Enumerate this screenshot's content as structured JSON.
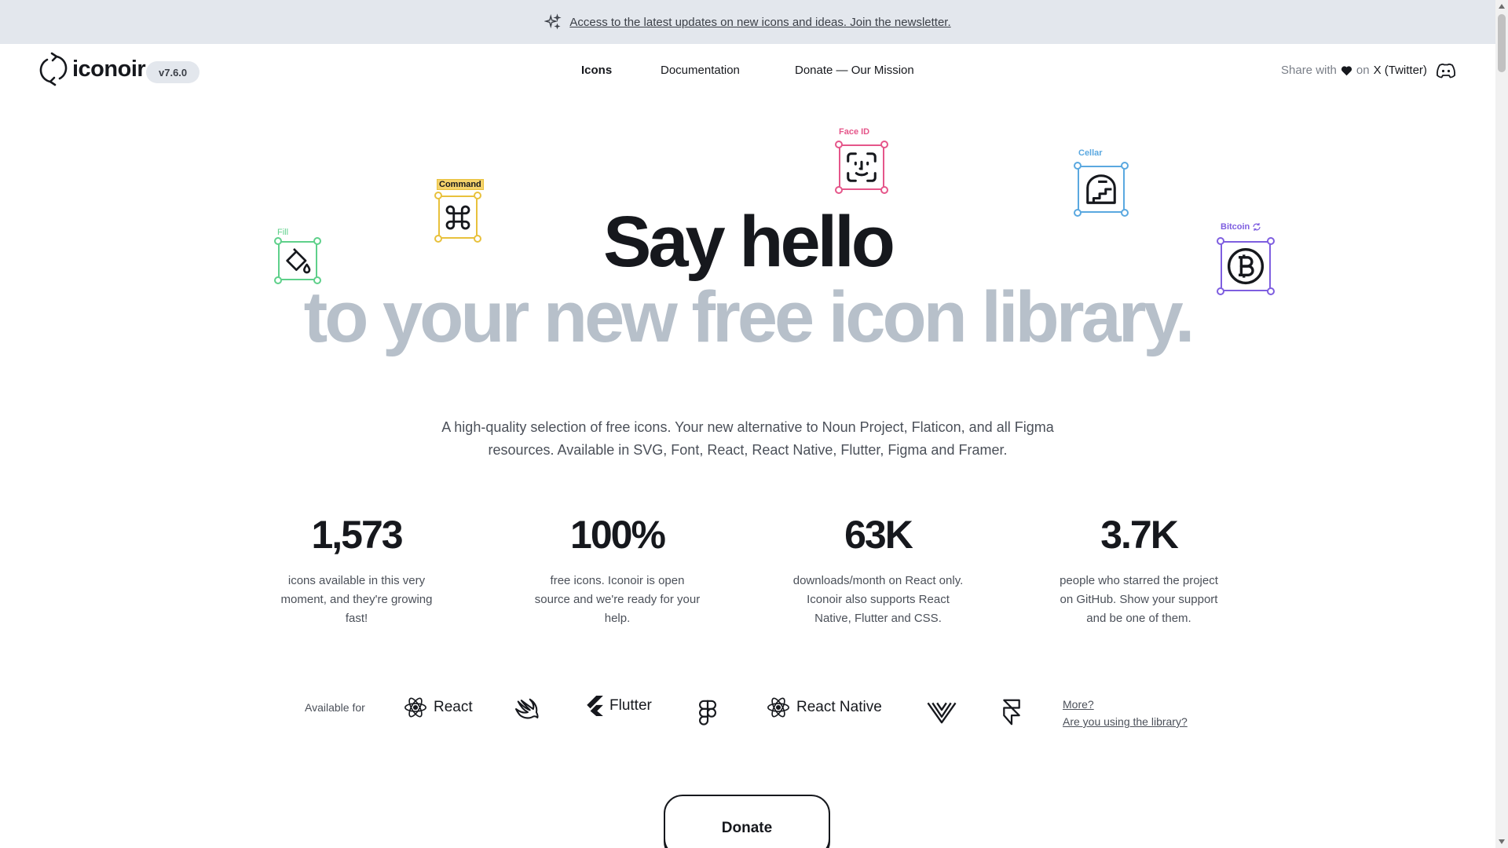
{
  "announcement": {
    "text": "Access to the latest updates on new icons and ideas. Join the newsletter.",
    "icon": "sparks-icon"
  },
  "header": {
    "logo_text": "iconoir",
    "version": "v7.6.0",
    "nav": [
      "Icons",
      "Documentation",
      "Donate — Our Mission"
    ],
    "share_prefix": "Share with",
    "share_on": "on",
    "share_target": "X (Twitter)"
  },
  "hero": {
    "line1": "Say hello",
    "line2": "to your new free icon library.",
    "subtitle": "A high-quality selection of free icons. Your new alternative to Noun Project, Flaticon, and all Figma resources. Available in SVG, Font, React, React Native, Flutter, Figma and Framer."
  },
  "floating_icons": [
    {
      "label": "Fill",
      "color": "#5ed08a"
    },
    {
      "label": "Command",
      "color": "#e8c13c"
    },
    {
      "label": "Face ID",
      "color": "#e5568a"
    },
    {
      "label": "Cellar",
      "color": "#5aa8e0"
    },
    {
      "label": "Bitcoin",
      "color": "#7e5ee0"
    }
  ],
  "stats": [
    {
      "value": "1,573",
      "desc": "icons available in this very moment, and they're growing fast!"
    },
    {
      "value": "100%",
      "desc": "free icons. Iconoir is open source and we're ready for your help."
    },
    {
      "value": "63K",
      "desc": "downloads/month on React only. Iconoir also supports React Native, Flutter and CSS."
    },
    {
      "value": "3.7K",
      "desc": "people who starred the project on GitHub. Show your support and be one of them."
    }
  ],
  "available": {
    "label": "Available for",
    "frameworks": [
      "React",
      "Flutter",
      "React Native"
    ],
    "more": "More?",
    "using": "Are you using the library?"
  },
  "donate_label": "Donate",
  "colors": {
    "banner_bg": "#e3e7ed",
    "hero_dark": "#16181d",
    "hero_light": "#b7c0ca"
  }
}
